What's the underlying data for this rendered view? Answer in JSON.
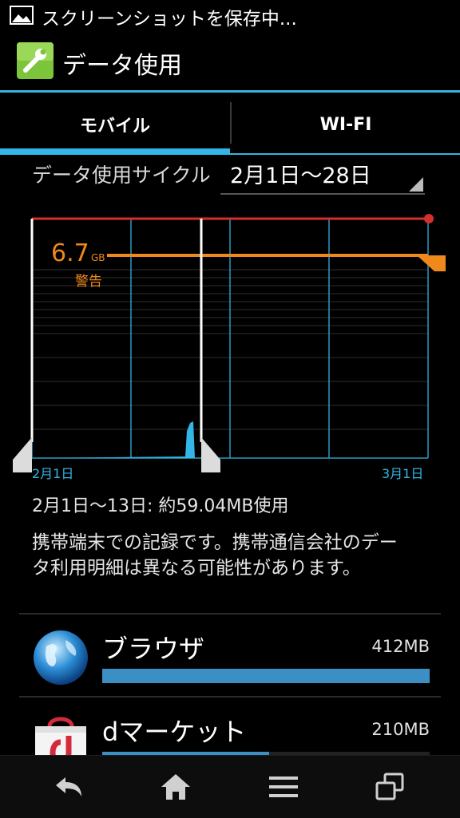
{
  "status_bar": {
    "text": "スクリーンショットを保存中..."
  },
  "action_bar": {
    "title": "データ使用",
    "icon": "wrench-settings-icon"
  },
  "tabs": [
    {
      "label": "モバイル",
      "selected": true
    },
    {
      "label": "WI-FI",
      "selected": false
    }
  ],
  "cycle": {
    "label": "データ使用サイクル",
    "value": "2月1日～28日"
  },
  "chart_data": {
    "type": "area",
    "x_start_label": "2月1日",
    "x_end_label": "3月1日",
    "warning": {
      "value": "6.7",
      "unit": "GB",
      "label": "警告"
    },
    "colors": {
      "limit": "#d32f2f",
      "warning": "#f0891b",
      "usage": "#33b5e5",
      "grid": "#33b5e5"
    }
  },
  "usage_summary": "2月1日～13日: 約59.04MB使用",
  "notice": "携帯端末での記録です。携帯通信会社のデータ利用明細は異なる可能性があります。",
  "apps": [
    {
      "name": "ブラウザ",
      "size": "412MB",
      "fraction": 1.0,
      "icon": "globe-icon"
    },
    {
      "name": "dマーケット",
      "size": "210MB",
      "fraction": 0.51,
      "icon": "dmarket-bag-icon"
    }
  ],
  "nav": [
    "back-icon",
    "home-icon",
    "menu-icon",
    "recent-apps-icon"
  ]
}
